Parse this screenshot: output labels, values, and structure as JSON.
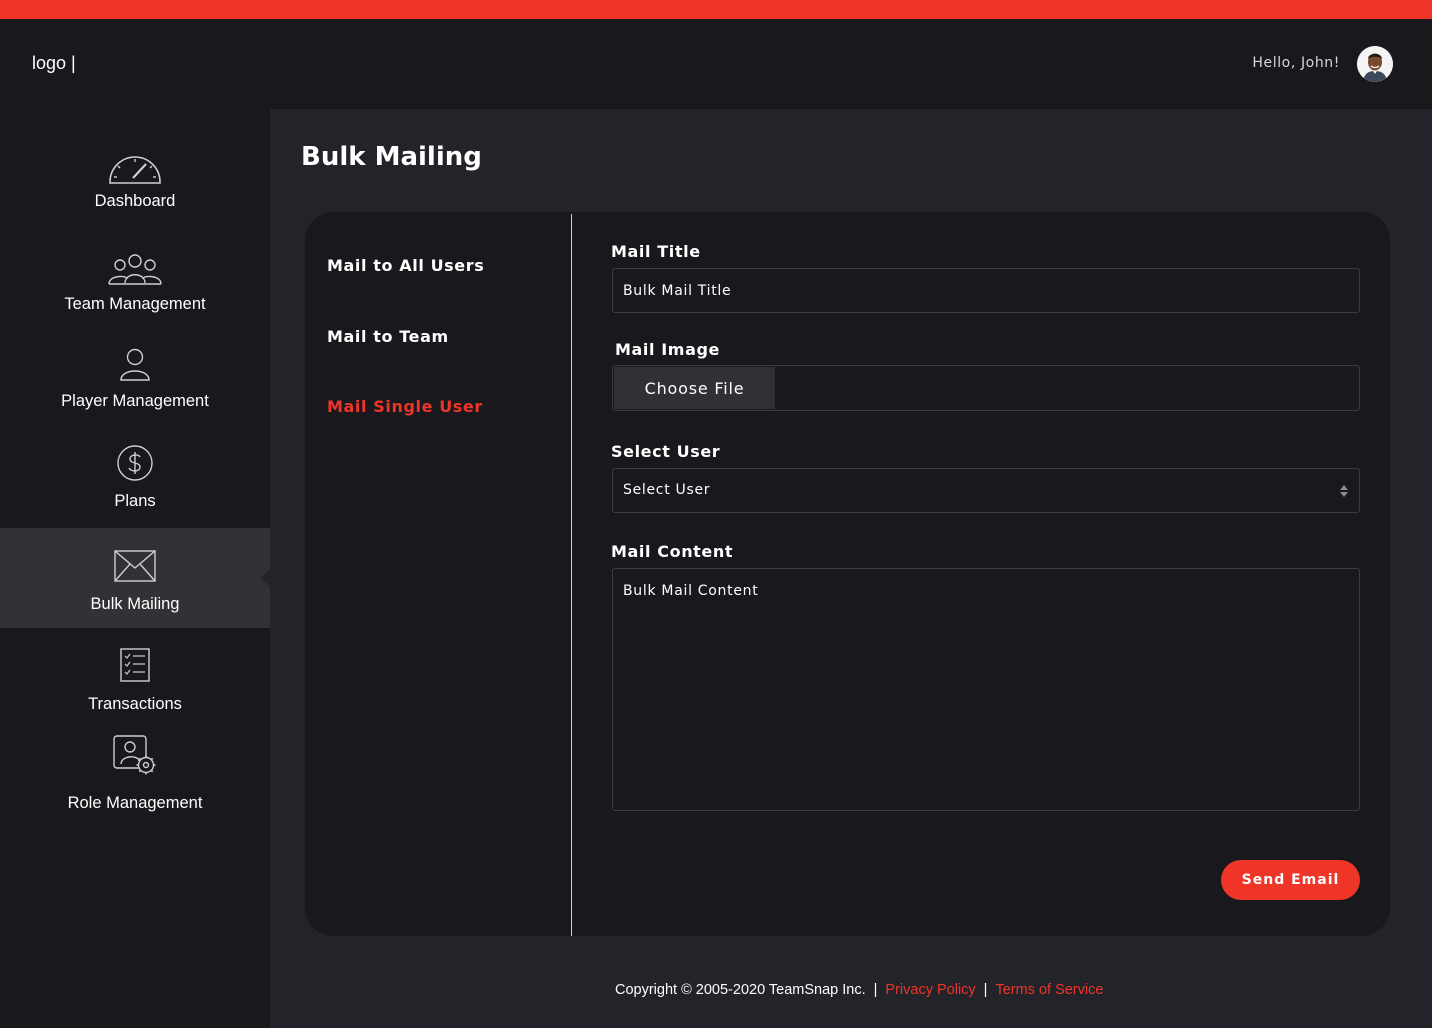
{
  "header": {
    "logo": "logo |",
    "greeting": "Hello, John!"
  },
  "sidebar": {
    "items": [
      {
        "label": "Dashboard",
        "icon": "speedometer-icon",
        "active": false
      },
      {
        "label": "Team Management",
        "icon": "team-icon",
        "active": false
      },
      {
        "label": "Player Management",
        "icon": "user-icon",
        "active": false
      },
      {
        "label": "Plans",
        "icon": "dollar-icon",
        "active": false
      },
      {
        "label": "Bulk Mailing",
        "icon": "envelope-icon",
        "active": true
      },
      {
        "label": "Transactions",
        "icon": "checklist-icon",
        "active": false
      },
      {
        "label": "Role Management",
        "icon": "user-gear-icon",
        "active": false
      }
    ]
  },
  "page": {
    "title": "Bulk Mailing"
  },
  "mail_options": [
    {
      "label": "Mail to All Users",
      "active": false
    },
    {
      "label": "Mail to Team",
      "active": false
    },
    {
      "label": "Mail Single User",
      "active": true
    }
  ],
  "form": {
    "mail_title_label": "Mail Title",
    "mail_title_value": "Bulk Mail Title",
    "mail_image_label": "Mail Image",
    "choose_file_label": "Choose File",
    "select_user_label": "Select User",
    "select_user_value": "Select User",
    "mail_content_label": "Mail Content",
    "mail_content_value": "Bulk Mail Content",
    "send_button": "Send Email"
  },
  "footer": {
    "copyright": "Copyright © 2005-2020 TeamSnap Inc.",
    "separator": "|",
    "privacy": "Privacy Policy",
    "terms": "Terms of Service"
  },
  "colors": {
    "accent": "#ee3528",
    "background": "#18181d",
    "main_background": "#23232a",
    "active_nav": "#323236"
  }
}
